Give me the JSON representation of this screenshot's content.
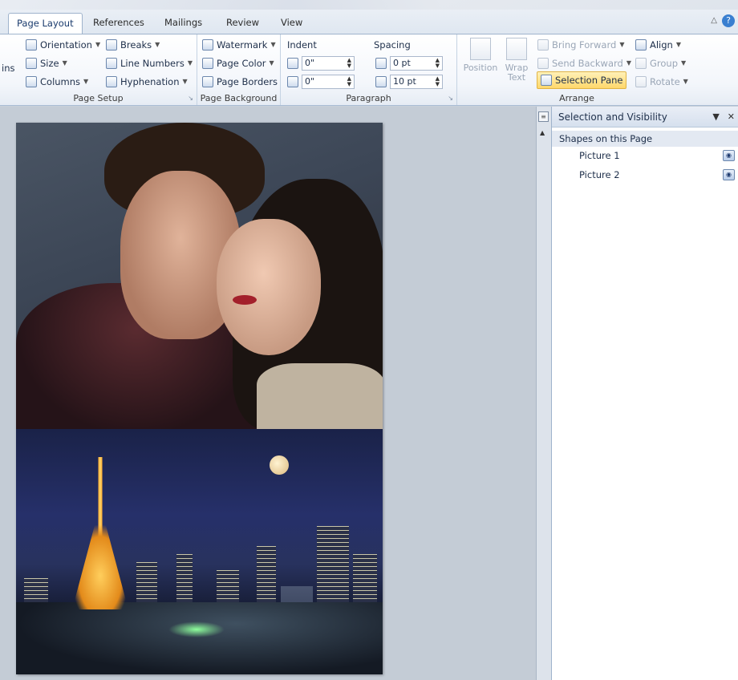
{
  "tabs": [
    {
      "label": "Page Layout",
      "active": true
    },
    {
      "label": "References"
    },
    {
      "label": "Mailings"
    },
    {
      "label": "Review"
    },
    {
      "label": "View"
    }
  ],
  "ribbon": {
    "page_setup": {
      "margins_partial": "ins",
      "orientation": "Orientation",
      "size": "Size",
      "columns": "Columns",
      "breaks": "Breaks",
      "line_numbers": "Line Numbers",
      "hyphenation": "Hyphenation",
      "label": "Page Setup"
    },
    "page_background": {
      "watermark": "Watermark",
      "page_color": "Page Color",
      "page_borders": "Page Borders",
      "label": "Page Background"
    },
    "paragraph": {
      "indent_label": "Indent",
      "spacing_label": "Spacing",
      "indent_left": "0\"",
      "indent_right": "0\"",
      "spacing_before": "0 pt",
      "spacing_after": "10 pt",
      "label": "Paragraph"
    },
    "arrange": {
      "position": "Position",
      "wrap_text_line1": "Wrap",
      "wrap_text_line2": "Text",
      "bring_forward": "Bring Forward",
      "send_backward": "Send Backward",
      "selection_pane": "Selection Pane",
      "align": "Align",
      "group": "Group",
      "rotate": "Rotate",
      "label": "Arrange"
    }
  },
  "selection_pane": {
    "title": "Selection and Visibility",
    "section_label": "Shapes on this Page",
    "shapes": [
      {
        "name": "Picture 1",
        "visible": true
      },
      {
        "name": "Picture 2",
        "visible": true
      }
    ]
  },
  "colors": {
    "selection_pane_highlight": "#ffd76b",
    "ribbon_border": "#9fb3cc",
    "workspace": "#c4ccd6"
  }
}
